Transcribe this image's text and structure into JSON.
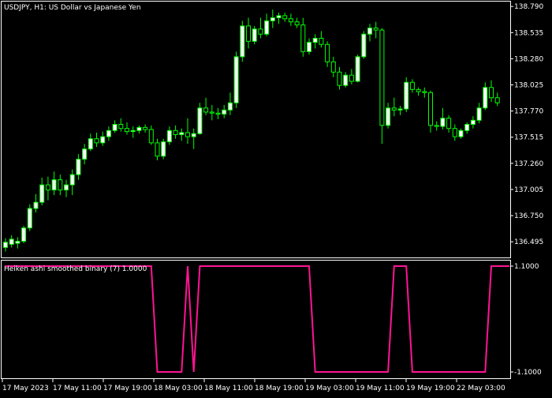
{
  "colors": {
    "background": "#000000",
    "frame": "#ffffff",
    "candle_up": "#ffffff",
    "candle_down": "#000000",
    "wick": "#00ff00",
    "indicator_line": "#ff1493",
    "text": "#ffffff"
  },
  "main_chart": {
    "symbol_label": "USDJPY, H1:  US Dollar vs Japanese Yen",
    "y_ticks": [
      "138.790",
      "138.535",
      "138.280",
      "138.025",
      "137.770",
      "137.515",
      "137.260",
      "137.005",
      "136.750",
      "136.495"
    ],
    "ylim": [
      136.35,
      138.83
    ]
  },
  "sub_chart": {
    "label": "Heiken ashi smoothed binary (7) 1.0000",
    "y_ticks": [
      "1.1000",
      "-1.1000"
    ],
    "ylim": [
      -1.1,
      1.1
    ]
  },
  "x_ticks": [
    "17 May 2023",
    "17 May 11:00",
    "17 May 19:00",
    "18 May 03:00",
    "18 May 11:00",
    "18 May 19:00",
    "19 May 03:00",
    "19 May 11:00",
    "19 May 19:00",
    "22 May 03:00"
  ],
  "chart_data": {
    "type": "candlestick",
    "series": [
      {
        "name": "USDJPY",
        "ohlc": [
          [
            136.44,
            136.53,
            136.4,
            136.49
          ],
          [
            136.47,
            136.56,
            136.44,
            136.52
          ],
          [
            136.48,
            136.54,
            136.43,
            136.5
          ],
          [
            136.5,
            136.65,
            136.48,
            136.63
          ],
          [
            136.63,
            136.86,
            136.6,
            136.82
          ],
          [
            136.82,
            136.96,
            136.78,
            136.88
          ],
          [
            136.88,
            137.12,
            136.85,
            137.05
          ],
          [
            137.05,
            137.13,
            136.9,
            137.0
          ],
          [
            137.0,
            137.18,
            136.95,
            137.1
          ],
          [
            137.1,
            137.15,
            136.95,
            137.0
          ],
          [
            137.0,
            137.1,
            136.93,
            137.05
          ],
          [
            137.05,
            137.2,
            136.95,
            137.15
          ],
          [
            137.15,
            137.35,
            137.1,
            137.3
          ],
          [
            137.3,
            137.45,
            137.25,
            137.4
          ],
          [
            137.4,
            137.55,
            137.38,
            137.5
          ],
          [
            137.5,
            137.56,
            137.42,
            137.46
          ],
          [
            137.46,
            137.57,
            137.43,
            137.52
          ],
          [
            137.52,
            137.62,
            137.48,
            137.58
          ],
          [
            137.58,
            137.68,
            137.56,
            137.64
          ],
          [
            137.64,
            137.7,
            137.57,
            137.6
          ],
          [
            137.6,
            137.66,
            137.54,
            137.57
          ],
          [
            137.57,
            137.62,
            137.51,
            137.58
          ],
          [
            137.58,
            137.63,
            137.55,
            137.61
          ],
          [
            137.61,
            137.64,
            137.56,
            137.59
          ],
          [
            137.59,
            137.63,
            137.44,
            137.46
          ],
          [
            137.46,
            137.5,
            137.29,
            137.33
          ],
          [
            137.33,
            137.5,
            137.3,
            137.47
          ],
          [
            137.47,
            137.62,
            137.44,
            137.58
          ],
          [
            137.58,
            137.63,
            137.5,
            137.54
          ],
          [
            137.54,
            137.6,
            137.48,
            137.56
          ],
          [
            137.56,
            137.7,
            137.45,
            137.52
          ],
          [
            137.52,
            137.6,
            137.4,
            137.55
          ],
          [
            137.55,
            137.85,
            137.54,
            137.8
          ],
          [
            137.8,
            137.9,
            137.73,
            137.76
          ],
          [
            137.76,
            137.83,
            137.68,
            137.75
          ],
          [
            137.75,
            137.8,
            137.69,
            137.74
          ],
          [
            137.74,
            137.83,
            137.7,
            137.78
          ],
          [
            137.78,
            137.95,
            137.73,
            137.85
          ],
          [
            137.85,
            138.35,
            137.8,
            138.3
          ],
          [
            138.3,
            138.65,
            138.25,
            138.6
          ],
          [
            138.6,
            138.68,
            138.38,
            138.45
          ],
          [
            138.45,
            138.6,
            138.42,
            138.57
          ],
          [
            138.57,
            138.68,
            138.48,
            138.52
          ],
          [
            138.52,
            138.72,
            138.5,
            138.65
          ],
          [
            138.65,
            138.76,
            138.58,
            138.68
          ],
          [
            138.68,
            138.73,
            138.62,
            138.7
          ],
          [
            138.7,
            138.73,
            138.64,
            138.67
          ],
          [
            138.67,
            138.72,
            138.6,
            138.64
          ],
          [
            138.64,
            138.68,
            138.58,
            138.61
          ],
          [
            138.61,
            138.68,
            138.3,
            138.35
          ],
          [
            138.35,
            138.48,
            138.32,
            138.44
          ],
          [
            138.44,
            138.52,
            138.38,
            138.48
          ],
          [
            138.48,
            138.55,
            138.39,
            138.42
          ],
          [
            138.42,
            138.45,
            138.2,
            138.25
          ],
          [
            138.25,
            138.3,
            138.1,
            138.15
          ],
          [
            138.15,
            138.2,
            137.98,
            138.02
          ],
          [
            138.02,
            138.15,
            138.0,
            138.12
          ],
          [
            138.12,
            138.18,
            138.03,
            138.06
          ],
          [
            138.06,
            138.32,
            138.05,
            138.3
          ],
          [
            138.3,
            138.55,
            138.28,
            138.52
          ],
          [
            138.52,
            138.62,
            138.45,
            138.58
          ],
          [
            138.58,
            138.64,
            138.48,
            138.56
          ],
          [
            138.56,
            138.58,
            137.45,
            137.63
          ],
          [
            137.63,
            137.85,
            137.6,
            137.8
          ],
          [
            137.8,
            137.9,
            137.72,
            137.78
          ],
          [
            137.78,
            137.82,
            137.73,
            137.79
          ],
          [
            137.79,
            138.1,
            137.76,
            138.05
          ],
          [
            138.05,
            138.08,
            137.95,
            137.98
          ],
          [
            137.98,
            138.0,
            137.92,
            137.96
          ],
          [
            137.96,
            138.0,
            137.9,
            137.95
          ],
          [
            137.95,
            137.97,
            137.56,
            137.63
          ],
          [
            137.63,
            137.67,
            137.58,
            137.62
          ],
          [
            137.62,
            137.8,
            137.59,
            137.7
          ],
          [
            137.7,
            137.73,
            137.56,
            137.6
          ],
          [
            137.6,
            137.64,
            137.48,
            137.52
          ],
          [
            137.52,
            137.6,
            137.5,
            137.58
          ],
          [
            137.58,
            137.66,
            137.55,
            137.64
          ],
          [
            137.64,
            137.72,
            137.6,
            137.68
          ],
          [
            137.68,
            137.85,
            137.65,
            137.8
          ],
          [
            137.8,
            138.05,
            137.78,
            138.0
          ],
          [
            138.0,
            138.07,
            137.86,
            137.9
          ],
          [
            137.9,
            137.95,
            137.82,
            137.85
          ]
        ]
      },
      {
        "name": "Heiken ashi smoothed binary (7)",
        "values": [
          1,
          1,
          1,
          1,
          1,
          1,
          1,
          1,
          1,
          1,
          1,
          1,
          1,
          1,
          1,
          1,
          1,
          1,
          1,
          1,
          1,
          1,
          1,
          1,
          1,
          -1,
          -1,
          -1,
          -1,
          -1,
          1,
          -1,
          1,
          1,
          1,
          1,
          1,
          1,
          1,
          1,
          1,
          1,
          1,
          1,
          1,
          1,
          1,
          1,
          1,
          1,
          1,
          -1,
          -1,
          -1,
          -1,
          -1,
          -1,
          -1,
          -1,
          -1,
          -1,
          -1,
          -1,
          -1,
          1,
          1,
          1,
          -1,
          -1,
          -1,
          -1,
          -1,
          -1,
          -1,
          -1,
          -1,
          -1,
          -1,
          -1,
          -1,
          1,
          1,
          1,
          1
        ]
      }
    ]
  }
}
